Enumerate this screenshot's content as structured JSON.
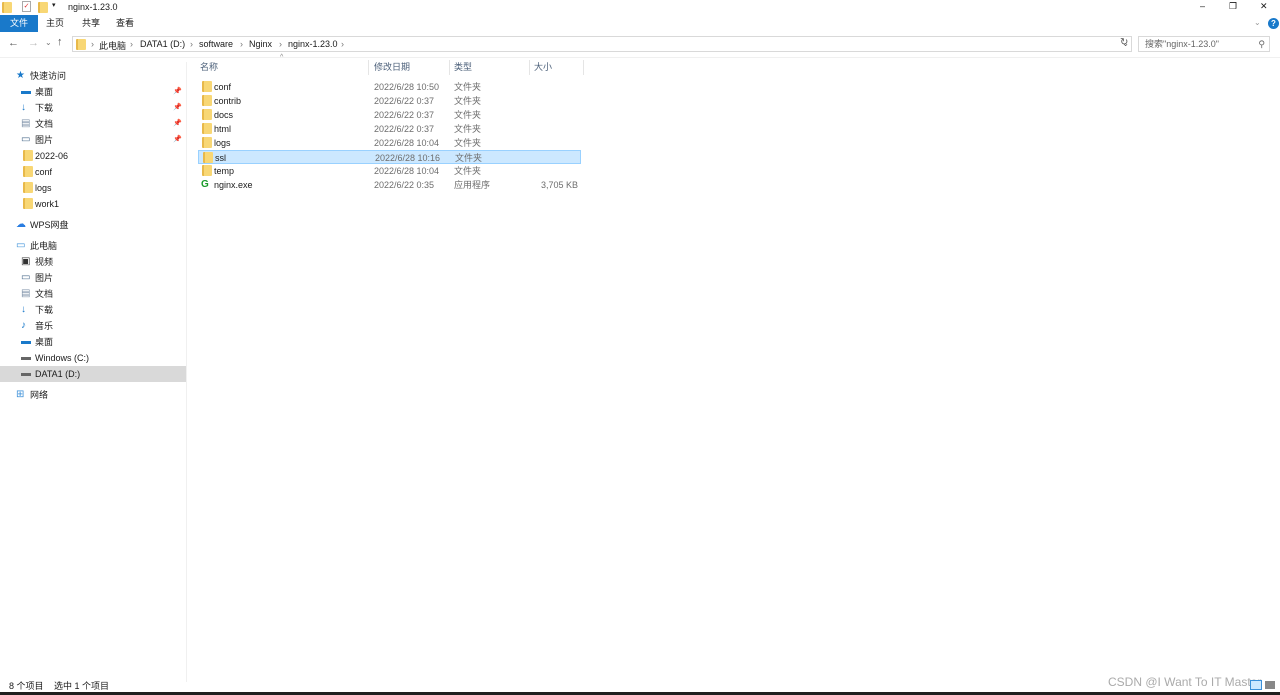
{
  "window": {
    "title": "nginx-1.23.0",
    "minimize": "–",
    "restore": "❐",
    "close": "✕",
    "help": "?"
  },
  "ribbon": {
    "tabs": [
      {
        "label": "文件"
      },
      {
        "label": "主页"
      },
      {
        "label": "共享"
      },
      {
        "label": "查看"
      }
    ]
  },
  "address": {
    "crumbs": [
      "此电脑",
      "DATA1 (D:)",
      "software",
      "Nginx",
      "nginx-1.23.0"
    ],
    "search_placeholder": "搜索\"nginx-1.23.0\""
  },
  "sidebar": {
    "items": [
      {
        "label": "快速访问",
        "icon": "star-icon",
        "level": 0,
        "pinned": false
      },
      {
        "label": "桌面",
        "icon": "desktop-icon",
        "level": 1,
        "pinned": true
      },
      {
        "label": "下载",
        "icon": "download-icon",
        "level": 1,
        "pinned": true
      },
      {
        "label": "文档",
        "icon": "document-icon",
        "level": 1,
        "pinned": true
      },
      {
        "label": "图片",
        "icon": "pictures-icon",
        "level": 1,
        "pinned": true
      },
      {
        "label": "2022-06",
        "icon": "folder-icon",
        "level": 1
      },
      {
        "label": "conf",
        "icon": "folder-icon",
        "level": 1
      },
      {
        "label": "logs",
        "icon": "folder-icon",
        "level": 1
      },
      {
        "label": "work1",
        "icon": "folder-icon",
        "level": 1
      },
      {
        "label": "WPS网盘",
        "icon": "cloud-icon",
        "level": 0
      },
      {
        "label": "此电脑",
        "icon": "computer-icon",
        "level": 0
      },
      {
        "label": "视频",
        "icon": "video-icon",
        "level": 1
      },
      {
        "label": "图片",
        "icon": "pictures-icon",
        "level": 1
      },
      {
        "label": "文档",
        "icon": "document-icon",
        "level": 1
      },
      {
        "label": "下载",
        "icon": "download-icon",
        "level": 1
      },
      {
        "label": "音乐",
        "icon": "music-icon",
        "level": 1
      },
      {
        "label": "桌面",
        "icon": "desktop-icon",
        "level": 1
      },
      {
        "label": "Windows (C:)",
        "icon": "drive-icon",
        "level": 1
      },
      {
        "label": "DATA1 (D:)",
        "icon": "drive-icon",
        "level": 1,
        "selected": true
      },
      {
        "label": "网络",
        "icon": "network-icon",
        "level": 0
      }
    ]
  },
  "columns": [
    "名称",
    "修改日期",
    "类型",
    "大小"
  ],
  "files": [
    {
      "name": "conf",
      "date": "2022/6/28 10:50",
      "type": "文件夹",
      "size": ""
    },
    {
      "name": "contrib",
      "date": "2022/6/22 0:37",
      "type": "文件夹",
      "size": ""
    },
    {
      "name": "docs",
      "date": "2022/6/22 0:37",
      "type": "文件夹",
      "size": ""
    },
    {
      "name": "html",
      "date": "2022/6/22 0:37",
      "type": "文件夹",
      "size": ""
    },
    {
      "name": "logs",
      "date": "2022/6/28 10:04",
      "type": "文件夹",
      "size": ""
    },
    {
      "name": "ssl",
      "date": "2022/6/28 10:16",
      "type": "文件夹",
      "size": "",
      "selected": true
    },
    {
      "name": "temp",
      "date": "2022/6/28 10:04",
      "type": "文件夹",
      "size": ""
    },
    {
      "name": "nginx.exe",
      "date": "2022/6/22 0:35",
      "type": "应用程序",
      "size": "3,705 KB",
      "exe": true
    }
  ],
  "status": {
    "count": "8 个项目",
    "selected": "选中 1 个项目"
  },
  "watermark": "CSDN @I Want To IT Master",
  "colors": {
    "accent": "#1979ca",
    "selection": "#cce8ff"
  }
}
